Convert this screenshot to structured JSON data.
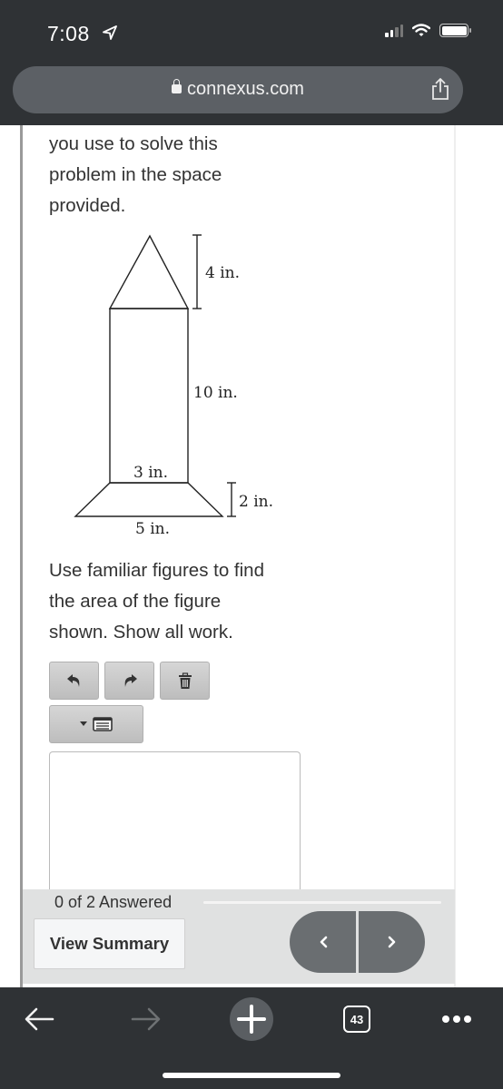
{
  "status_bar": {
    "time": "7:08",
    "location_icon": "location-arrow-icon",
    "signal_icon": "cellular-signal-icon",
    "wifi_icon": "wifi-icon",
    "battery_icon": "battery-icon"
  },
  "url_bar": {
    "lock_icon": "lock-icon",
    "domain": "connexus.com",
    "share_icon": "share-icon"
  },
  "question": {
    "prompt_top_lines": [
      "you use to solve this",
      "problem in the space",
      "provided."
    ],
    "prompt_bottom_lines": [
      "Use familiar figures to find",
      "the area of the figure",
      "shown. Show all work."
    ],
    "figure": {
      "labels": {
        "triangle_height": "4 in.",
        "rectangle_height": "10 in.",
        "rectangle_width": "3 in.",
        "trapezoid_height": "2 in.",
        "trapezoid_base": "5 in."
      }
    }
  },
  "toolbar": {
    "undo_icon": "undo-icon",
    "redo_icon": "redo-icon",
    "delete_icon": "trash-icon",
    "format_dropdown_icon": "list-format-icon"
  },
  "answer_box": {
    "value": ""
  },
  "footer": {
    "answered_text": "0 of 2 Answered",
    "progress": 0,
    "view_summary_label": "View Summary",
    "prev_icon": "chevron-left-icon",
    "next_icon": "chevron-right-icon"
  },
  "browser_toolbar": {
    "back_icon": "back-arrow-icon",
    "forward_icon": "forward-arrow-icon",
    "new_tab_icon": "plus-icon",
    "tab_count": "43",
    "menu_icon": "more-dots-icon"
  },
  "colors": {
    "chrome_dark": "#2f3235",
    "url_bar": "#5c6065",
    "nav_button": "#6a6e71",
    "footer_bg": "#e0e1e1",
    "text": "#333333"
  }
}
